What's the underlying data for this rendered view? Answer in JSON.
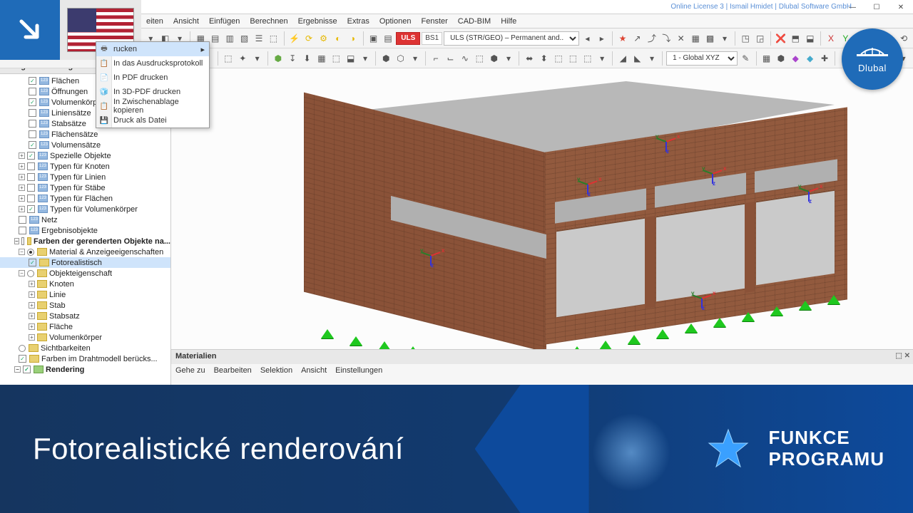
{
  "titlebar": {
    "license": "Online License 3 | Ismail Hmidet | Dlubal Software GmbH"
  },
  "win": {
    "min": "—",
    "max": "☐",
    "close": "✕"
  },
  "menubar": [
    "eiten",
    "Ansicht",
    "Einfügen",
    "Berechnen",
    "Ergebnisse",
    "Extras",
    "Optionen",
    "Fenster",
    "CAD-BIM",
    "Hilfe"
  ],
  "dropdown": {
    "items": [
      "rucken",
      "In das Ausdrucksprotokoll",
      "In PDF drucken",
      "In 3D-PDF drucken",
      "In Zwischenablage kopieren",
      "Druck als Datei"
    ],
    "active_index": 0
  },
  "toolbar1": {
    "uls_tag": "ULS",
    "uls_code": "BS1",
    "combo": "ULS (STR/GEO) – Permanent and...",
    "coord": "1 - Global XYZ"
  },
  "navigator": {
    "title": "Navigator - Anzeige",
    "rows": [
      {
        "lvl": 2,
        "cb": "chk",
        "icn": "",
        "label": "Flächen"
      },
      {
        "lvl": 2,
        "cb": "",
        "icn": "",
        "label": "Öffnungen"
      },
      {
        "lvl": 2,
        "cb": "chk",
        "icn": "",
        "label": "Volumenkörp"
      },
      {
        "lvl": 2,
        "cb": "",
        "icn": "",
        "label": "Liniensätze"
      },
      {
        "lvl": 2,
        "cb": "",
        "icn": "",
        "label": "Stabsätze"
      },
      {
        "lvl": 2,
        "cb": "",
        "icn": "",
        "label": "Flächensätze"
      },
      {
        "lvl": 2,
        "cb": "chk",
        "icn": "",
        "label": "Volumensätze"
      },
      {
        "lvl": 1,
        "ex": ">",
        "cb": "chk",
        "icn": "",
        "label": "Spezielle Objekte"
      },
      {
        "lvl": 1,
        "ex": ">",
        "cb": "",
        "icn": "",
        "label": "Typen für Knoten"
      },
      {
        "lvl": 1,
        "ex": ">",
        "cb": "",
        "icn": "",
        "label": "Typen für Linien"
      },
      {
        "lvl": 1,
        "ex": ">",
        "cb": "",
        "icn": "",
        "label": "Typen für Stäbe"
      },
      {
        "lvl": 1,
        "ex": ">",
        "cb": "",
        "icn": "",
        "label": "Typen für Flächen"
      },
      {
        "lvl": 1,
        "ex": ">",
        "cb": "chk",
        "icn": "",
        "label": "Typen für Volumenkörper"
      },
      {
        "lvl": 1,
        "cb": "",
        "icn": "",
        "label": "Netz"
      },
      {
        "lvl": 1,
        "cb": "",
        "icn": "",
        "label": "Ergebnisobjekte"
      },
      {
        "lvl": 0,
        "ex": "v",
        "cb": "",
        "icn": "y",
        "label": "Farben der gerenderten Objekte na...",
        "bold": true
      },
      {
        "lvl": 1,
        "ex": "v",
        "rb": "sel",
        "icn": "y",
        "label": "Material & Anzeigeeigenschaften"
      },
      {
        "lvl": 2,
        "cb": "chk",
        "icn": "y",
        "label": "Fotorealistisch",
        "active": true
      },
      {
        "lvl": 1,
        "ex": "v",
        "rb": "",
        "icn": "y",
        "label": "Objekteigenschaft"
      },
      {
        "lvl": 2,
        "ex": ">",
        "icn": "y",
        "label": "Knoten"
      },
      {
        "lvl": 2,
        "ex": ">",
        "icn": "y",
        "label": "Linie"
      },
      {
        "lvl": 2,
        "ex": ">",
        "icn": "y",
        "label": "Stab"
      },
      {
        "lvl": 2,
        "ex": ">",
        "icn": "y",
        "label": "Stabsatz"
      },
      {
        "lvl": 2,
        "ex": ">",
        "icn": "y",
        "label": "Fläche"
      },
      {
        "lvl": 2,
        "ex": ">",
        "icn": "y",
        "label": "Volumenkörper"
      },
      {
        "lvl": 1,
        "rb": "",
        "icn": "y",
        "label": "Sichtbarkeiten"
      },
      {
        "lvl": 1,
        "cb": "chk",
        "icn": "y",
        "label": "Farben im Drahtmodell berücks..."
      },
      {
        "lvl": 0,
        "ex": "v",
        "cb": "chk",
        "icn": "g",
        "label": "Rendering",
        "bold": true
      }
    ]
  },
  "materials": {
    "title": "Materialien",
    "menu": [
      "Gehe zu",
      "Bearbeiten",
      "Selektion",
      "Ansicht",
      "Einstellungen"
    ]
  },
  "banner": {
    "title": "Fotorealistické renderování",
    "tag1": "FUNKCE",
    "tag2": "PROGRAMU"
  },
  "badge": {
    "name": "Dlubal"
  },
  "icons": {
    "print": "🖶",
    "pdf": "📄",
    "clip": "📋",
    "file": "💾",
    "chevd": "▾"
  }
}
